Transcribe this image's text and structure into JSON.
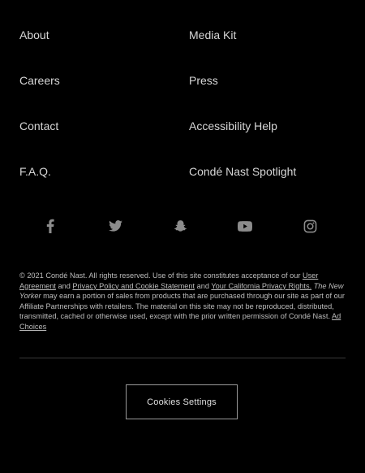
{
  "footer_links": {
    "left": [
      "About",
      "Careers",
      "Contact",
      "F.A.Q."
    ],
    "right": [
      "Media Kit",
      "Press",
      "Accessibility Help",
      "Condé Nast Spotlight"
    ]
  },
  "social": [
    {
      "name": "facebook-icon"
    },
    {
      "name": "twitter-icon"
    },
    {
      "name": "snapchat-icon"
    },
    {
      "name": "youtube-icon"
    },
    {
      "name": "instagram-icon"
    }
  ],
  "legal": {
    "part1": "© 2021 Condé Nast. All rights reserved. Use of this site constitutes acceptance of our",
    "user_agreement": "User Agreement",
    "and1": "and",
    "privacy_policy": "Privacy Policy and Cookie Statement",
    "and2": "and",
    "california": "Your California Privacy Rights.",
    "publication": "The New Yorker",
    "part2": "may earn a portion of sales from products that are purchased through our site as part of our Affiliate Partnerships with retailers. The material on this site may not be reproduced, distributed, transmitted, cached or otherwise used, except with the prior written permission of Condé Nast.",
    "ad_choices": "Ad Choices"
  },
  "cookies_button": "Cookies Settings",
  "colors": {
    "background": "#000000",
    "text": "#d6d6d6",
    "icon": "#8c8c8c"
  }
}
